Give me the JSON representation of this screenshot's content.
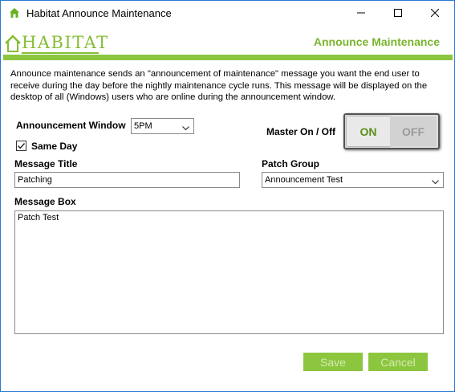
{
  "window": {
    "title": "Habitat Announce Maintenance",
    "icon": "home-icon",
    "controls": [
      "minimize-icon",
      "maximize-icon",
      "close-icon"
    ]
  },
  "header": {
    "logo_text": "HABITAT",
    "title": "Announce Maintenance"
  },
  "description": "Announce maintenance sends an \"announcement of maintenance\" message you want the end user to receive during the day before the nightly maintenance cycle runs. This message will be displayed on the desktop of all (Windows) users who are online during the announcement window.",
  "form": {
    "announcement_window_label": "Announcement Window",
    "announcement_window_value": "5PM",
    "same_day_label": "Same Day",
    "same_day_checked": true,
    "master_label": "Master On / Off",
    "toggle_on_label": "ON",
    "toggle_off_label": "OFF",
    "toggle_state": "ON",
    "message_title_label": "Message Title",
    "message_title_value": "Patching",
    "patch_group_label": "Patch Group",
    "patch_group_value": "Announcement Test",
    "message_box_label": "Message Box",
    "message_box_value": "Patch Test"
  },
  "buttons": {
    "save": "Save",
    "cancel": "Cancel"
  },
  "colors": {
    "accent": "#8cc63f",
    "window_border": "#2b79d7",
    "title_green": "#7ab52e"
  }
}
